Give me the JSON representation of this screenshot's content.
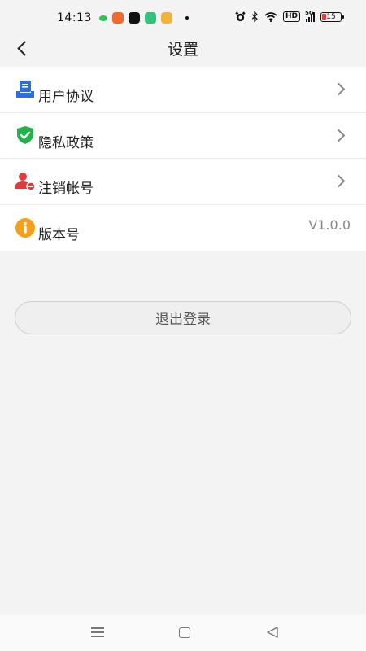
{
  "status_bar": {
    "time": "14:13",
    "battery": "15",
    "hd": "HD",
    "signal": "5G",
    "app_colors": [
      "#2fbf56",
      "#ef6a2c",
      "#111111",
      "#31c27c",
      "#f1b43b"
    ]
  },
  "header": {
    "title": "设置"
  },
  "settings": [
    {
      "label": "用户协议",
      "icon": "document-icon",
      "has_chevron": true
    },
    {
      "label": "隐私政策",
      "icon": "shield-check-icon",
      "has_chevron": true
    },
    {
      "label": "注销帐号",
      "icon": "user-remove-icon",
      "has_chevron": true
    },
    {
      "label": "版本号",
      "icon": "info-icon",
      "value": "V1.0.0"
    }
  ],
  "logout": {
    "label": "退出登录"
  },
  "colors": {
    "accent_blue": "#2e6de0",
    "green": "#22b24c",
    "red": "#e23a3a",
    "orange": "#f3a11c"
  }
}
